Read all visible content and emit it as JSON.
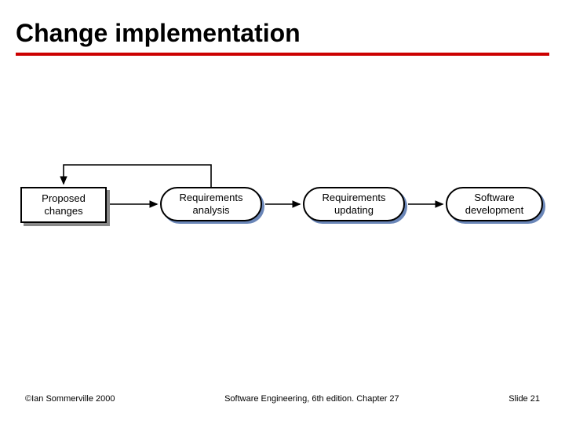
{
  "title": "Change implementation",
  "diagram": {
    "nodes": {
      "proposed": {
        "line1": "Proposed",
        "line2": "changes"
      },
      "analysis": {
        "line1": "Requirements",
        "line2": "analysis"
      },
      "updating": {
        "line1": "Requirements",
        "line2": "updating"
      },
      "development": {
        "line1": "Software",
        "line2": "development"
      }
    },
    "flow_description": "Proposed changes → Requirements analysis → Requirements updating → Software development, with feedback loop from Requirements analysis back to Proposed changes"
  },
  "footer": {
    "left": "©Ian Sommerville 2000",
    "center": "Software Engineering, 6th edition. Chapter 27",
    "right": "Slide 21"
  }
}
